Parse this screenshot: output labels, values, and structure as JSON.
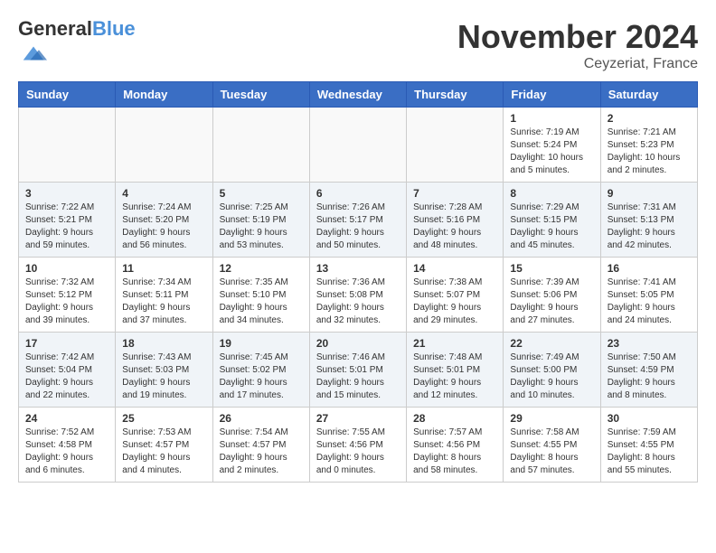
{
  "header": {
    "logo_general": "General",
    "logo_blue": "Blue",
    "month_title": "November 2024",
    "location": "Ceyzeriat, France"
  },
  "calendar": {
    "days_of_week": [
      "Sunday",
      "Monday",
      "Tuesday",
      "Wednesday",
      "Thursday",
      "Friday",
      "Saturday"
    ],
    "weeks": [
      [
        {
          "day": "",
          "info": ""
        },
        {
          "day": "",
          "info": ""
        },
        {
          "day": "",
          "info": ""
        },
        {
          "day": "",
          "info": ""
        },
        {
          "day": "",
          "info": ""
        },
        {
          "day": "1",
          "info": "Sunrise: 7:19 AM\nSunset: 5:24 PM\nDaylight: 10 hours and 5 minutes."
        },
        {
          "day": "2",
          "info": "Sunrise: 7:21 AM\nSunset: 5:23 PM\nDaylight: 10 hours and 2 minutes."
        }
      ],
      [
        {
          "day": "3",
          "info": "Sunrise: 7:22 AM\nSunset: 5:21 PM\nDaylight: 9 hours and 59 minutes."
        },
        {
          "day": "4",
          "info": "Sunrise: 7:24 AM\nSunset: 5:20 PM\nDaylight: 9 hours and 56 minutes."
        },
        {
          "day": "5",
          "info": "Sunrise: 7:25 AM\nSunset: 5:19 PM\nDaylight: 9 hours and 53 minutes."
        },
        {
          "day": "6",
          "info": "Sunrise: 7:26 AM\nSunset: 5:17 PM\nDaylight: 9 hours and 50 minutes."
        },
        {
          "day": "7",
          "info": "Sunrise: 7:28 AM\nSunset: 5:16 PM\nDaylight: 9 hours and 48 minutes."
        },
        {
          "day": "8",
          "info": "Sunrise: 7:29 AM\nSunset: 5:15 PM\nDaylight: 9 hours and 45 minutes."
        },
        {
          "day": "9",
          "info": "Sunrise: 7:31 AM\nSunset: 5:13 PM\nDaylight: 9 hours and 42 minutes."
        }
      ],
      [
        {
          "day": "10",
          "info": "Sunrise: 7:32 AM\nSunset: 5:12 PM\nDaylight: 9 hours and 39 minutes."
        },
        {
          "day": "11",
          "info": "Sunrise: 7:34 AM\nSunset: 5:11 PM\nDaylight: 9 hours and 37 minutes."
        },
        {
          "day": "12",
          "info": "Sunrise: 7:35 AM\nSunset: 5:10 PM\nDaylight: 9 hours and 34 minutes."
        },
        {
          "day": "13",
          "info": "Sunrise: 7:36 AM\nSunset: 5:08 PM\nDaylight: 9 hours and 32 minutes."
        },
        {
          "day": "14",
          "info": "Sunrise: 7:38 AM\nSunset: 5:07 PM\nDaylight: 9 hours and 29 minutes."
        },
        {
          "day": "15",
          "info": "Sunrise: 7:39 AM\nSunset: 5:06 PM\nDaylight: 9 hours and 27 minutes."
        },
        {
          "day": "16",
          "info": "Sunrise: 7:41 AM\nSunset: 5:05 PM\nDaylight: 9 hours and 24 minutes."
        }
      ],
      [
        {
          "day": "17",
          "info": "Sunrise: 7:42 AM\nSunset: 5:04 PM\nDaylight: 9 hours and 22 minutes."
        },
        {
          "day": "18",
          "info": "Sunrise: 7:43 AM\nSunset: 5:03 PM\nDaylight: 9 hours and 19 minutes."
        },
        {
          "day": "19",
          "info": "Sunrise: 7:45 AM\nSunset: 5:02 PM\nDaylight: 9 hours and 17 minutes."
        },
        {
          "day": "20",
          "info": "Sunrise: 7:46 AM\nSunset: 5:01 PM\nDaylight: 9 hours and 15 minutes."
        },
        {
          "day": "21",
          "info": "Sunrise: 7:48 AM\nSunset: 5:01 PM\nDaylight: 9 hours and 12 minutes."
        },
        {
          "day": "22",
          "info": "Sunrise: 7:49 AM\nSunset: 5:00 PM\nDaylight: 9 hours and 10 minutes."
        },
        {
          "day": "23",
          "info": "Sunrise: 7:50 AM\nSunset: 4:59 PM\nDaylight: 9 hours and 8 minutes."
        }
      ],
      [
        {
          "day": "24",
          "info": "Sunrise: 7:52 AM\nSunset: 4:58 PM\nDaylight: 9 hours and 6 minutes."
        },
        {
          "day": "25",
          "info": "Sunrise: 7:53 AM\nSunset: 4:57 PM\nDaylight: 9 hours and 4 minutes."
        },
        {
          "day": "26",
          "info": "Sunrise: 7:54 AM\nSunset: 4:57 PM\nDaylight: 9 hours and 2 minutes."
        },
        {
          "day": "27",
          "info": "Sunrise: 7:55 AM\nSunset: 4:56 PM\nDaylight: 9 hours and 0 minutes."
        },
        {
          "day": "28",
          "info": "Sunrise: 7:57 AM\nSunset: 4:56 PM\nDaylight: 8 hours and 58 minutes."
        },
        {
          "day": "29",
          "info": "Sunrise: 7:58 AM\nSunset: 4:55 PM\nDaylight: 8 hours and 57 minutes."
        },
        {
          "day": "30",
          "info": "Sunrise: 7:59 AM\nSunset: 4:55 PM\nDaylight: 8 hours and 55 minutes."
        }
      ]
    ]
  }
}
